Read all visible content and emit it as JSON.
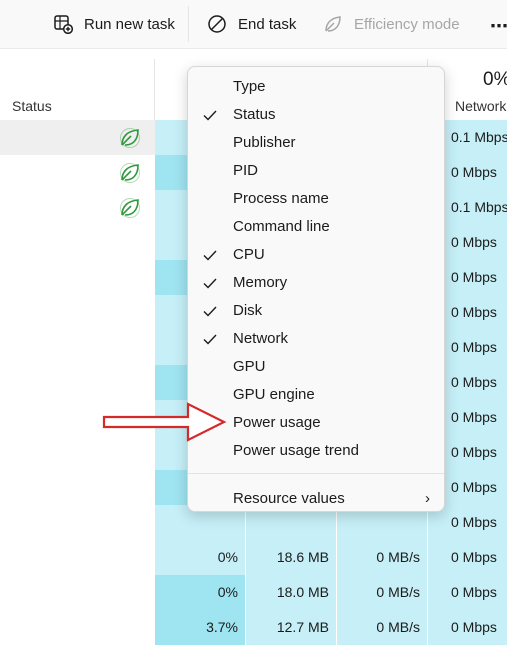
{
  "toolbar": {
    "run_new_task": "Run new task",
    "end_task": "End task",
    "efficiency_mode": "Efficiency mode",
    "more": "⋯"
  },
  "header": {
    "status": "Status",
    "network_pct": "0%",
    "network": "Network"
  },
  "rows": [
    {
      "leaf": true,
      "net": "0.1 Mbps"
    },
    {
      "leaf": true,
      "net": "0 Mbps"
    },
    {
      "leaf": true,
      "net": "0.1 Mbps"
    },
    {
      "leaf": false,
      "net": "0 Mbps"
    },
    {
      "leaf": false,
      "net": "0 Mbps"
    },
    {
      "leaf": false,
      "net": "0 Mbps"
    },
    {
      "leaf": false,
      "net": "0 Mbps"
    },
    {
      "leaf": false,
      "net": "0 Mbps"
    },
    {
      "leaf": false,
      "net": "0 Mbps"
    },
    {
      "leaf": false,
      "net": "0 Mbps"
    },
    {
      "leaf": false,
      "net": "0 Mbps"
    },
    {
      "leaf": false,
      "net": "0 Mbps"
    },
    {
      "leaf": false,
      "cpu": "0%",
      "mem": "18.6 MB",
      "disk": "0 MB/s",
      "net": "0 Mbps"
    },
    {
      "leaf": false,
      "cpu": "0%",
      "mem": "18.0 MB",
      "disk": "0 MB/s",
      "net": "0 Mbps"
    },
    {
      "leaf": false,
      "cpu": "3.7%",
      "mem": "12.7 MB",
      "disk": "0 MB/s",
      "net": "0 Mbps"
    }
  ],
  "menu": {
    "items": [
      {
        "label": "Type",
        "checked": false
      },
      {
        "label": "Status",
        "checked": true
      },
      {
        "label": "Publisher",
        "checked": false
      },
      {
        "label": "PID",
        "checked": false
      },
      {
        "label": "Process name",
        "checked": false
      },
      {
        "label": "Command line",
        "checked": false
      },
      {
        "label": "CPU",
        "checked": true
      },
      {
        "label": "Memory",
        "checked": true
      },
      {
        "label": "Disk",
        "checked": true
      },
      {
        "label": "Network",
        "checked": true
      },
      {
        "label": "GPU",
        "checked": false
      },
      {
        "label": "GPU engine",
        "checked": false
      },
      {
        "label": "Power usage",
        "checked": false
      },
      {
        "label": "Power usage trend",
        "checked": false
      }
    ],
    "resource_values": "Resource values",
    "submenu_glyph": "›"
  },
  "colors": {
    "highlight": "#c6eff7",
    "highlight_strong": "#9fe4f1",
    "leaf_green": "#2e9a3c",
    "arrow_red": "#d42a2a"
  }
}
